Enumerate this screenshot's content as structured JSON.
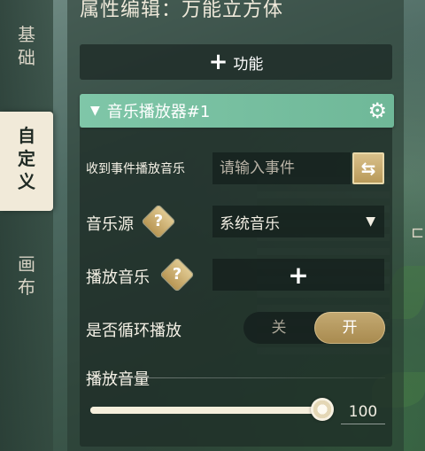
{
  "title": "属性编辑：万能立方体",
  "sidebar": {
    "tabs": [
      {
        "label": "基\n础"
      },
      {
        "label": "自\n定\n义"
      },
      {
        "label": "画\n布"
      }
    ]
  },
  "add_function_label": "功能",
  "module": {
    "name": "音乐播放器#1"
  },
  "rows": {
    "event_label": "收到事件播放音乐",
    "event_placeholder": "请输入事件",
    "source_label": "音乐源",
    "source_value": "系统音乐",
    "play_label": "播放音乐",
    "loop_label": "是否循环播放",
    "loop_off": "关",
    "loop_on": "开",
    "volume_label": "播放音量",
    "volume_value": "100"
  },
  "volume": {
    "value": 100,
    "max": 100
  },
  "icons": {
    "add": "plus-icon",
    "collapse": "triangle-down-icon",
    "settings": "gear-icon",
    "swap": "swap-arrows-icon",
    "help": "question-icon",
    "dropdown": "caret-down-icon"
  },
  "colors": {
    "module_header": "#7fc6a8",
    "accent_gold": "#c4aa73",
    "active_tab_bg": "#f1ead9"
  }
}
